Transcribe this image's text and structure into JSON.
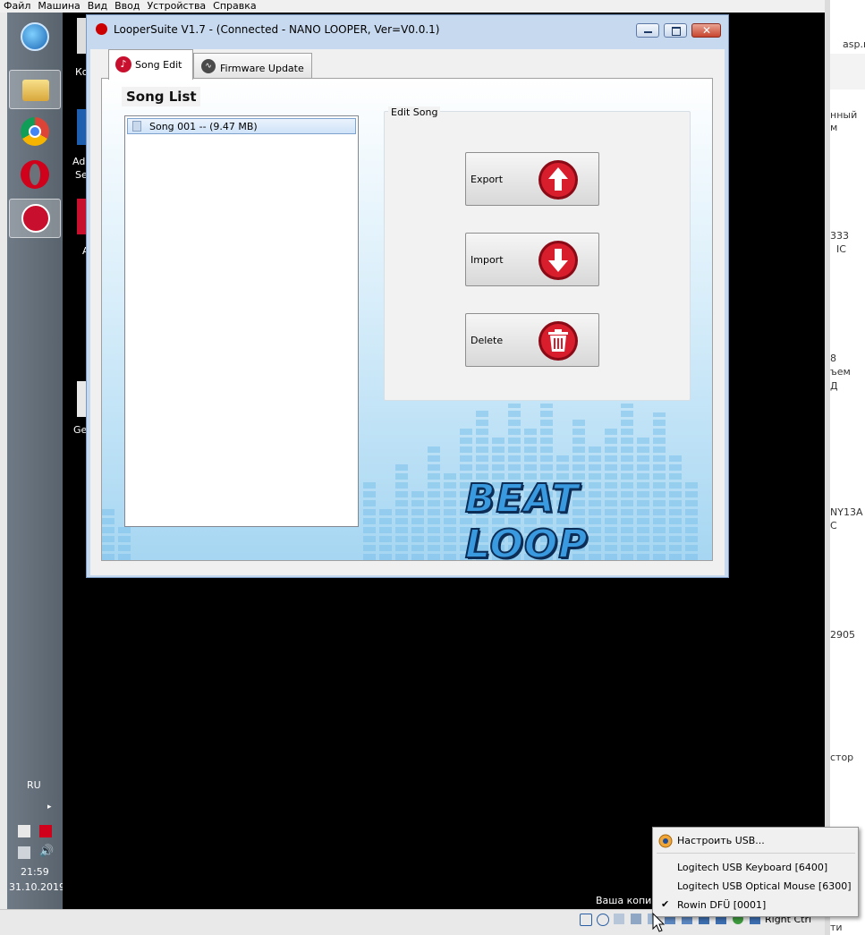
{
  "host_menu": [
    "Файл",
    "Машина",
    "Вид",
    "Ввод",
    "Устройства",
    "Справка"
  ],
  "host_right_texts": [
    "asp.r",
    "нный",
    "м",
    "333",
    "IC",
    "8",
    "ъем",
    "Д",
    "NY13A",
    "C",
    "2905",
    "стор",
    "ти"
  ],
  "desktop_fragments": [
    "Ко",
    "Ad",
    "Se",
    "А",
    "Ge"
  ],
  "app_window": {
    "title": "LooperSuite V1.7 - (Connected - NANO LOOPER, Ver=V0.0.1)",
    "tabs": [
      {
        "label": "Song Edit",
        "icon": "music-note-icon",
        "selected": true
      },
      {
        "label": "Firmware Update",
        "icon": "chart-line-icon",
        "selected": false
      }
    ],
    "song_list": {
      "header": "Song List",
      "items": [
        "Song 001 -- (9.47  MB)"
      ]
    },
    "edit_song": {
      "legend": "Edit Song",
      "buttons": [
        {
          "label": "Export",
          "icon": "arrow-up-icon"
        },
        {
          "label": "Import",
          "icon": "arrow-down-icon"
        },
        {
          "label": "Delete",
          "icon": "trash-icon"
        }
      ]
    },
    "logo_text": "BEAT LOOP"
  },
  "system_tray": {
    "language": "RU",
    "time": "21:59",
    "date": "31.10.2019"
  },
  "usb_menu": {
    "configure": "Настроить USB...",
    "devices": [
      {
        "label": "Logitech USB Keyboard [6400]",
        "checked": false
      },
      {
        "label": "Logitech USB Optical Mouse [6300]",
        "checked": false
      },
      {
        "label": "Rowin DFÜ [0001]",
        "checked": true
      }
    ]
  },
  "vbox_status": {
    "copy_text": "Ваша копия",
    "host_key": "Right Ctrl"
  },
  "colors": {
    "taskbar": "#5f6a75",
    "accent_red": "#c8102e",
    "logo_blue": "#3a9ae0",
    "panel_sky": "#a6d6f2"
  }
}
